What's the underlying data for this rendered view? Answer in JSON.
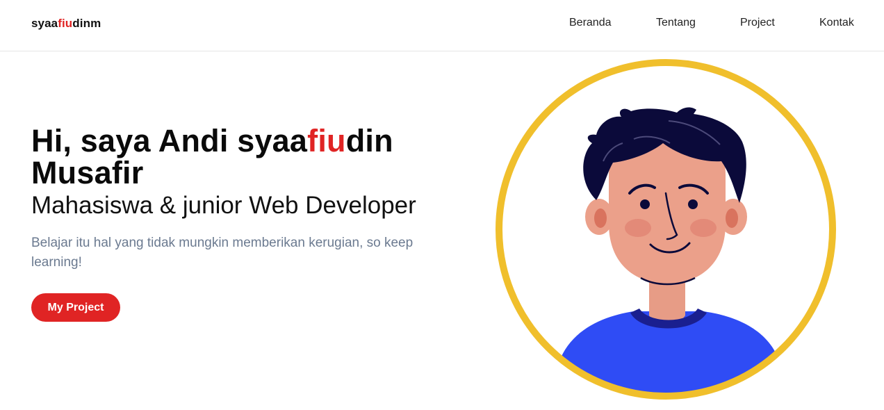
{
  "navbar": {
    "logo": {
      "prefix": "syaa",
      "accent": "fiu",
      "suffix": "dinm"
    },
    "links": [
      "Beranda",
      "Tentang",
      "Project",
      "Kontak"
    ]
  },
  "hero": {
    "title_prefix": "Hi, saya Andi syaa",
    "title_accent": "fiu",
    "title_suffix": "din",
    "title_line2": "Musafir",
    "subtitle": "Mahasiswa & junior Web Developer",
    "description": "Belajar itu hal yang tidak mungkin memberikan kerugian, so keep learning!",
    "button_label": "My Project"
  },
  "colors": {
    "accent": "#e02424",
    "ring": "#f0bf2c",
    "hair": "#0b0a3a",
    "skin": "#eba08a",
    "shirt": "#2f4cf5",
    "collar": "#1a1f8f",
    "description_text": "#6b7a90"
  },
  "avatar": {
    "icon": "avatar-illustration"
  }
}
